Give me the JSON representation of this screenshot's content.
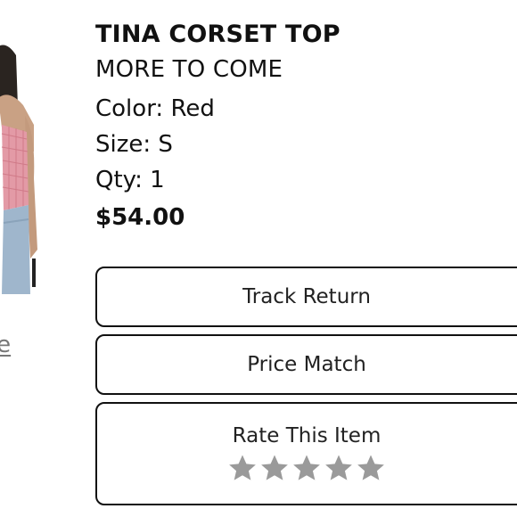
{
  "product": {
    "name": "TINA CORSET TOP",
    "brand": "MORE TO COME",
    "color": "Color: Red",
    "size": "Size: S",
    "qty": "Qty: 1",
    "price": "$54.00"
  },
  "left_link": {
    "visible_text": "re"
  },
  "actions": {
    "track_return_label": "Track Return",
    "price_match_label": "Price Match",
    "rate_label": "Rate This Item"
  },
  "rating": {
    "max_stars": 5,
    "selected": 0,
    "star_color": "#9a9a9a"
  },
  "colors": {
    "text": "#111111",
    "border": "#111111",
    "link": "#777777"
  }
}
